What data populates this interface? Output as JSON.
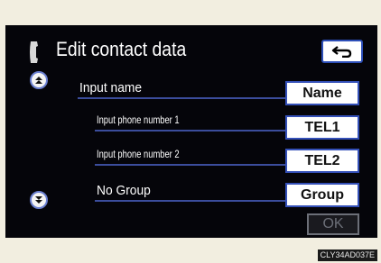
{
  "header": {
    "title": "Edit contact data",
    "phone_icon": "phone-handset-icon",
    "back_icon": "return-arrow-icon"
  },
  "scroll": {
    "up_icon": "double-chevron-up-icon",
    "down_icon": "double-chevron-down-icon"
  },
  "rows": [
    {
      "label": "Input name",
      "button": "Name"
    },
    {
      "label": "Input phone number 1",
      "button": "TEL1"
    },
    {
      "label": "Input phone number 2",
      "button": "TEL2"
    },
    {
      "label": "No Group",
      "button": "Group"
    }
  ],
  "ok_label": "OK",
  "image_code": "CLY34AD037E",
  "colors": {
    "screen_bg": "#05050a",
    "accent_blue": "#3450b8",
    "button_bg": "#ffffff",
    "disabled_gray": "#6c6f78"
  }
}
